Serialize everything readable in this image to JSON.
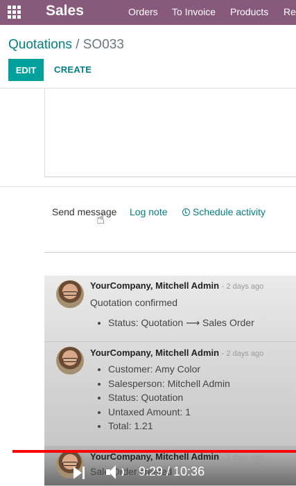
{
  "navbar": {
    "brand": "Sales",
    "menu": [
      "Orders",
      "To Invoice",
      "Products",
      "Rep"
    ]
  },
  "control_panel": {
    "breadcrumb_parent": "Quotations",
    "breadcrumb_sep": "/",
    "breadcrumb_current": "SO033",
    "edit_label": "EDIT",
    "create_label": "CREATE"
  },
  "chatter": {
    "send_message": "Send message",
    "log_note": "Log note",
    "schedule_activity": "Schedule activity",
    "messages": [
      {
        "author": "YourCompany, Mitchell Admin",
        "date": "- 2 days ago",
        "body": "Quotation confirmed",
        "tracking": [
          "Status: Quotation ⟶ Sales Order"
        ]
      },
      {
        "author": "YourCompany, Mitchell Admin",
        "date": "- 2 days ago",
        "body": "",
        "tracking": [
          "Customer: Amy Color",
          "Salesperson: Mitchell Admin",
          "Status: Quotation",
          "Untaxed Amount: 1",
          "Total: 1.21"
        ]
      },
      {
        "author": "YourCompany, Mitchell Admin",
        "date": "- 2 days ago",
        "body": "Sale Order created",
        "tracking": []
      }
    ]
  },
  "video": {
    "time": "9:29 / 10:36",
    "progress": 0.894
  },
  "colors": {
    "navbar": "#875A7B",
    "accent": "#00A09D",
    "link": "#017e84"
  }
}
